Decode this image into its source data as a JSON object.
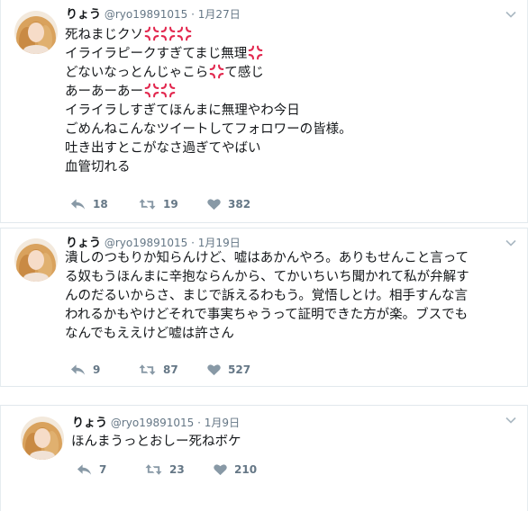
{
  "tweets": [
    {
      "name": "りょう",
      "handle": "@ryo19891015",
      "separator": "·",
      "date": "1月27日",
      "lines": [
        "死ねまじクソ",
        "イライラピークすぎてまじ無理",
        "どないなっとんじゃこら",
        "あーあーあー",
        "イライラしすぎてほんまに無理やわ今日",
        "ごめんねこんなツイートしてフォロワーの皆様。",
        "吐き出すとこがなさ過ぎてやばい",
        "血管切れる"
      ],
      "line_suffixes": [
        "",
        "",
        "て感じ",
        "",
        "",
        "",
        "",
        ""
      ],
      "replies": "18",
      "retweets": "19",
      "likes": "382"
    },
    {
      "name": "りょう",
      "handle": "@ryo19891015",
      "separator": "·",
      "date": "1月19日",
      "lines": [
        "潰しのつもりか知らんけど、嘘はあかんやろ。ありもせんこと言って",
        "る奴もうほんまに辛抱ならんから、てかいちいち聞かれて私が弁解す",
        "んのだるいからさ、まじで訴えるわもう。覚悟しとけ。相手すんな言",
        "われるかもやけどそれで事実ちゃうって証明できた方が楽。ブスでも",
        "なんでもええけど嘘は許さん"
      ],
      "replies": "9",
      "retweets": "87",
      "likes": "527"
    },
    {
      "name": "りょう",
      "handle": "@ryo19891015",
      "separator": "·",
      "date": "1月9日",
      "lines": [
        "ほんまうっとおしー死ねボケ"
      ],
      "replies": "7",
      "retweets": "23",
      "likes": "210"
    }
  ],
  "icons": {
    "emoji": "anger-symbol-icon",
    "reply": "reply-icon",
    "retweet": "retweet-icon",
    "like": "heart-icon",
    "menu": "chevron-down-icon"
  },
  "colors": {
    "text": "#14171a",
    "muted": "#657786",
    "anger": "#e2264d",
    "border": "#e1e8ed"
  }
}
